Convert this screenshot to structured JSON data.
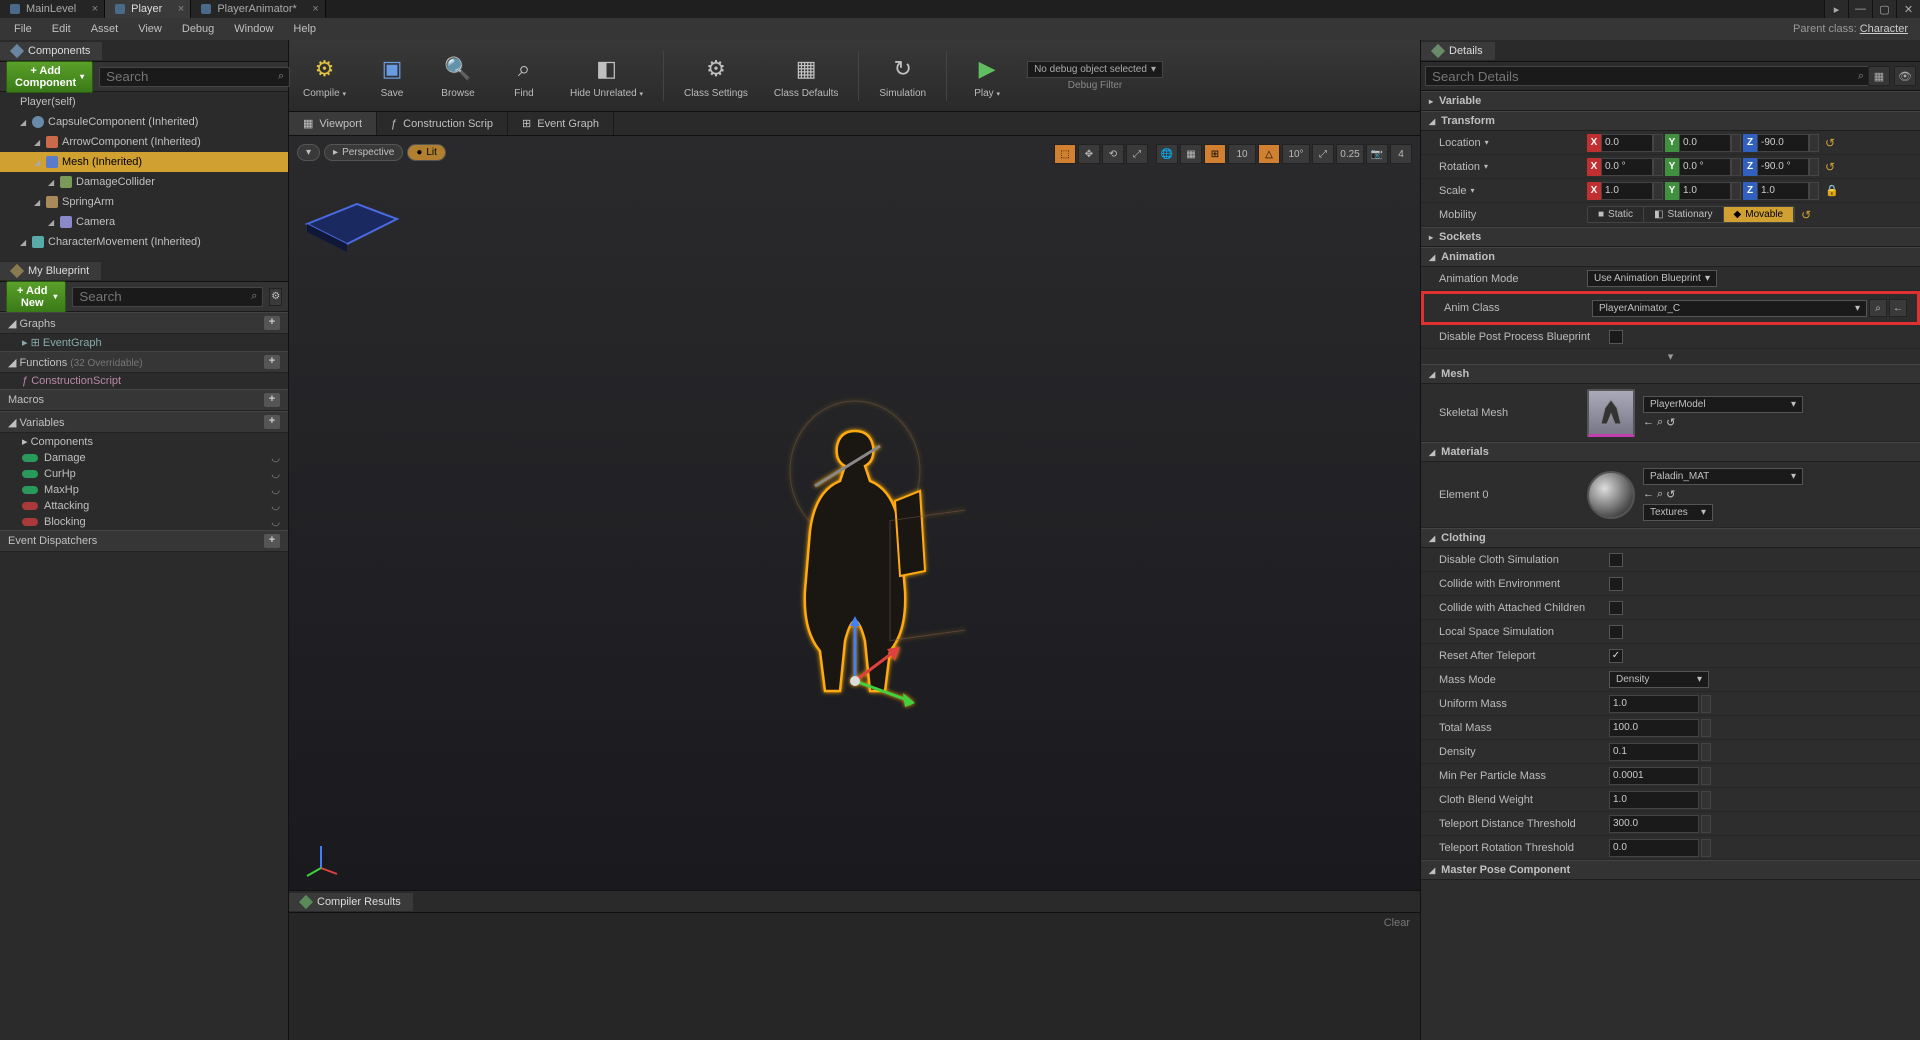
{
  "windowTabs": [
    {
      "label": "MainLevel",
      "active": false
    },
    {
      "label": "Player",
      "active": true
    },
    {
      "label": "PlayerAnimator*",
      "active": false
    }
  ],
  "menus": [
    "File",
    "Edit",
    "Asset",
    "View",
    "Debug",
    "Window",
    "Help"
  ],
  "parentClassLabel": "Parent class:",
  "parentClass": "Character",
  "componentsPanel": {
    "title": "Components",
    "addBtn": "+ Add Component",
    "searchPlaceholder": "Search",
    "root": "Player(self)",
    "items": [
      {
        "label": "CapsuleComponent (Inherited)",
        "indent": 1,
        "icon": "capsule"
      },
      {
        "label": "ArrowComponent (Inherited)",
        "indent": 2,
        "icon": "arrow"
      },
      {
        "label": "Mesh (Inherited)",
        "indent": 2,
        "icon": "mesh",
        "selected": true
      },
      {
        "label": "DamageCollider",
        "indent": 3,
        "icon": "box"
      },
      {
        "label": "SpringArm",
        "indent": 2,
        "icon": "spring"
      },
      {
        "label": "Camera",
        "indent": 3,
        "icon": "cam"
      },
      {
        "label": "CharacterMovement (Inherited)",
        "indent": 1,
        "icon": "move"
      }
    ]
  },
  "myBlueprint": {
    "title": "My Blueprint",
    "addBtn": "+ Add New",
    "searchPlaceholder": "Search",
    "graphs": {
      "title": "Graphs",
      "items": [
        "EventGraph"
      ]
    },
    "functions": {
      "title": "Functions",
      "note": "(32 Overridable)",
      "items": [
        "ConstructionScript"
      ]
    },
    "macros": {
      "title": "Macros"
    },
    "variables": {
      "title": "Variables",
      "componentsLbl": "Components",
      "items": [
        {
          "name": "Damage",
          "color": "green"
        },
        {
          "name": "CurHp",
          "color": "green"
        },
        {
          "name": "MaxHp",
          "color": "green"
        },
        {
          "name": "Attacking",
          "color": "red"
        },
        {
          "name": "Blocking",
          "color": "red"
        }
      ]
    },
    "dispatchers": {
      "title": "Event Dispatchers"
    }
  },
  "toolbar": [
    {
      "label": "Compile",
      "icon": "⚙",
      "cls": "ticon-compile",
      "dd": true
    },
    {
      "label": "Save",
      "icon": "▣",
      "cls": "ticon-save"
    },
    {
      "label": "Browse",
      "icon": "🔍",
      "cls": ""
    },
    {
      "label": "Find",
      "icon": "⌕",
      "cls": ""
    },
    {
      "label": "Hide Unrelated",
      "icon": "◧",
      "cls": "",
      "dd": true
    },
    {
      "sep": true
    },
    {
      "label": "Class Settings",
      "icon": "⚙",
      "cls": ""
    },
    {
      "label": "Class Defaults",
      "icon": "▦",
      "cls": ""
    },
    {
      "sep": true
    },
    {
      "label": "Simulation",
      "icon": "↻",
      "cls": ""
    },
    {
      "sep": true
    },
    {
      "label": "Play",
      "icon": "▶",
      "cls": "ticon-play",
      "dd": true
    }
  ],
  "debugSelector": "No debug object selected",
  "debugFilterLabel": "Debug Filter",
  "centerTabs": [
    {
      "label": "Viewport",
      "icon": "▦",
      "active": true
    },
    {
      "label": "Construction Scrip",
      "icon": "ƒ"
    },
    {
      "label": "Event Graph",
      "icon": "⊞"
    }
  ],
  "vpModes": {
    "dropdown": "▾",
    "perspective": "Perspective",
    "lit": "Lit"
  },
  "vpTopRight": {
    "snap1": "10",
    "angle": "10°",
    "scale": "0.25",
    "cam": "4"
  },
  "compilerTab": "Compiler Results",
  "clearLabel": "Clear",
  "details": {
    "title": "Details",
    "searchPlaceholder": "Search Details",
    "variable": "Variable",
    "transform": {
      "title": "Transform",
      "location": {
        "label": "Location",
        "x": "0.0",
        "y": "0.0",
        "z": "-90.0"
      },
      "rotation": {
        "label": "Rotation",
        "x": "0.0 °",
        "y": "0.0 °",
        "z": "-90.0 °"
      },
      "scale": {
        "label": "Scale",
        "x": "1.0",
        "y": "1.0",
        "z": "1.0"
      },
      "mobility": {
        "label": "Mobility",
        "opts": [
          "Static",
          "Stationary",
          "Movable"
        ],
        "active": 2
      }
    },
    "sockets": "Sockets",
    "animation": {
      "title": "Animation",
      "modeLabel": "Animation Mode",
      "modeValue": "Use Animation Blueprint",
      "classLabel": "Anim Class",
      "classValue": "PlayerAnimator_C",
      "disablePP": "Disable Post Process Blueprint"
    },
    "mesh": {
      "title": "Mesh",
      "skelLabel": "Skeletal Mesh",
      "skelValue": "PlayerModel"
    },
    "materials": {
      "title": "Materials",
      "elemLabel": "Element 0",
      "matValue": "Paladin_MAT",
      "texBtn": "Textures"
    },
    "clothing": {
      "title": "Clothing",
      "rows": [
        {
          "label": "Disable Cloth Simulation",
          "type": "check",
          "val": false
        },
        {
          "label": "Collide with Environment",
          "type": "check",
          "val": false
        },
        {
          "label": "Collide with Attached Children",
          "type": "check",
          "val": false
        },
        {
          "label": "Local Space Simulation",
          "type": "check",
          "val": false
        },
        {
          "label": "Reset After Teleport",
          "type": "check",
          "val": true
        },
        {
          "label": "Mass Mode",
          "type": "drop",
          "val": "Density"
        },
        {
          "label": "Uniform Mass",
          "type": "num",
          "val": "1.0"
        },
        {
          "label": "Total Mass",
          "type": "num",
          "val": "100.0"
        },
        {
          "label": "Density",
          "type": "num",
          "val": "0.1"
        },
        {
          "label": "Min Per Particle Mass",
          "type": "num",
          "val": "0.0001"
        },
        {
          "label": "Cloth Blend Weight",
          "type": "num",
          "val": "1.0"
        },
        {
          "label": "Teleport Distance Threshold",
          "type": "num",
          "val": "300.0"
        },
        {
          "label": "Teleport Rotation Threshold",
          "type": "num",
          "val": "0.0"
        }
      ]
    },
    "masterPose": "Master Pose Component"
  }
}
